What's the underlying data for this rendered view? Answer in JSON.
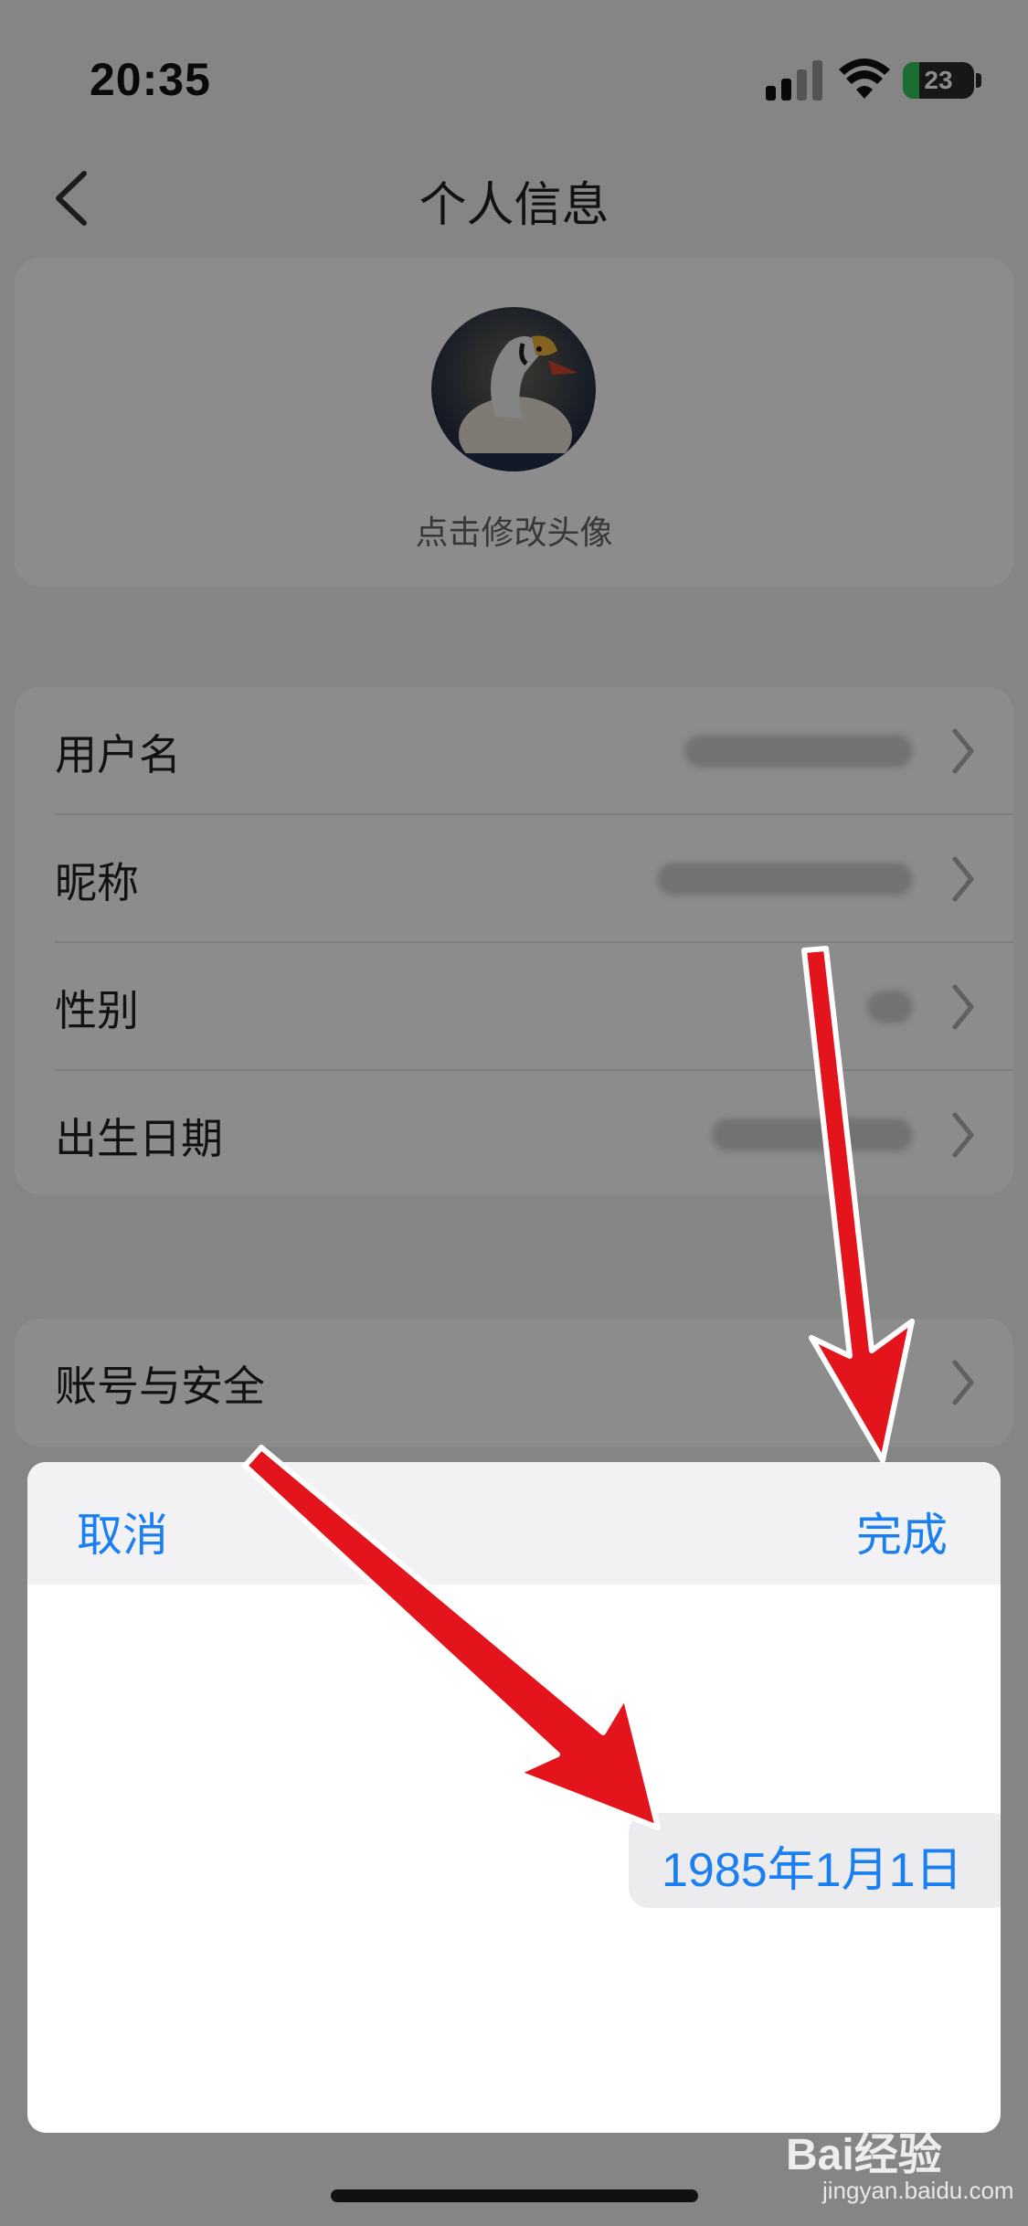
{
  "status_bar": {
    "time": "20:35",
    "battery_level": 23,
    "battery_text": "23"
  },
  "nav": {
    "title": "个人信息"
  },
  "avatar_section": {
    "hint": "点击修改头像"
  },
  "profile_rows": [
    {
      "label": "用户名"
    },
    {
      "label": "昵称"
    },
    {
      "label": "性别"
    },
    {
      "label": "出生日期"
    }
  ],
  "security_row": {
    "label": "账号与安全"
  },
  "date_picker": {
    "cancel_label": "取消",
    "done_label": "完成",
    "selected_date": "1985年1月1日"
  },
  "watermark": {
    "brand": "Bai经验",
    "url": "jingyan.baidu.com"
  },
  "colors": {
    "accent": "#1a7ff0",
    "annotation_arrow": "#e3141b"
  },
  "icons": [
    "back-chevron-icon",
    "chevron-right-icon",
    "signal-icon",
    "wifi-icon",
    "battery-icon"
  ]
}
